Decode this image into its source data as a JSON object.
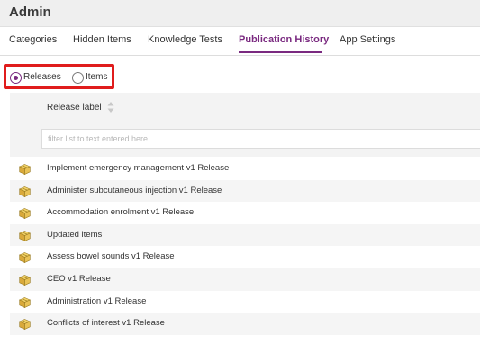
{
  "header": {
    "title": "Admin"
  },
  "tabs": [
    {
      "label": "Categories"
    },
    {
      "label": "Hidden Items"
    },
    {
      "label": "Knowledge Tests"
    },
    {
      "label": "Publication History",
      "active": true
    },
    {
      "label": "App Settings"
    }
  ],
  "filter_mode": {
    "options": [
      {
        "label": "Releases",
        "checked": true
      },
      {
        "label": "Items",
        "checked": false
      }
    ]
  },
  "table": {
    "column_label": "Release label",
    "filter_placeholder": "filter list to text entered here",
    "rows": [
      {
        "label": "Implement emergency management v1 Release",
        "icon": "package-icon"
      },
      {
        "label": "Administer subcutaneous injection v1 Release",
        "icon": "package-icon"
      },
      {
        "label": "Accommodation enrolment v1 Release",
        "icon": "package-icon"
      },
      {
        "label": "Updated items",
        "icon": "package-icon"
      },
      {
        "label": "Assess bowel sounds v1 Release",
        "icon": "package-icon"
      },
      {
        "label": "CEO v1 Release",
        "icon": "package-icon"
      },
      {
        "label": "Administration v1 Release",
        "icon": "package-icon"
      },
      {
        "label": "Conflicts of interest v1 Release",
        "icon": "package-icon"
      }
    ]
  },
  "colors": {
    "accent": "#7a2a80",
    "highlight_box": "#e01c1c",
    "header_bg": "#efefef",
    "table_head_bg": "#f3f3f3"
  }
}
